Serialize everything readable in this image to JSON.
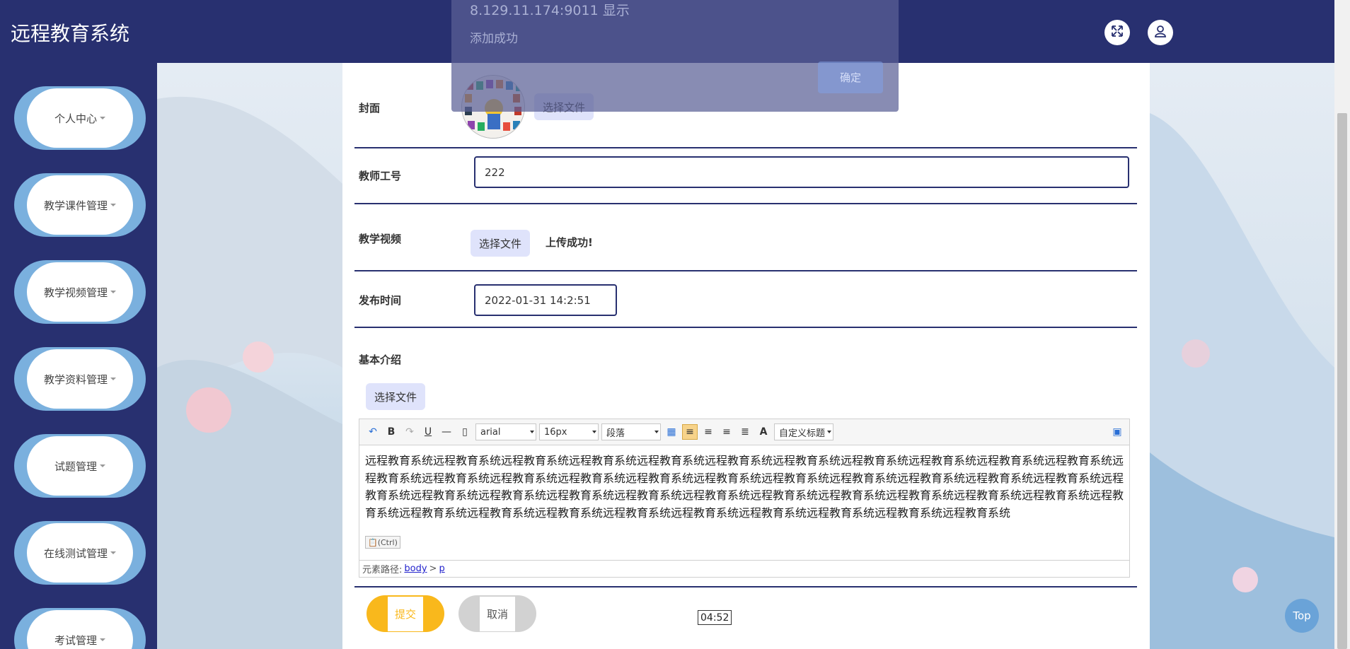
{
  "app": {
    "title": "远程教育系统"
  },
  "header": {
    "fullscreen_icon": "fullscreen-icon",
    "user_icon": "user-icon"
  },
  "sidebar": {
    "items": [
      {
        "label": "个人中心"
      },
      {
        "label": "教学课件管理"
      },
      {
        "label": "教学视频管理"
      },
      {
        "label": "教学资料管理"
      },
      {
        "label": "试题管理"
      },
      {
        "label": "在线测试管理"
      },
      {
        "label": "考试管理"
      }
    ]
  },
  "form": {
    "cover": {
      "label": "封面",
      "choose": "选择文件"
    },
    "teacher_id": {
      "label": "教师工号",
      "value": "222"
    },
    "video": {
      "label": "教学视频",
      "choose": "选择文件",
      "status": "上传成功!"
    },
    "publish_time": {
      "label": "发布时间",
      "value": "2022-01-31 14:2:51"
    },
    "intro": {
      "label": "基本介绍",
      "choose": "选择文件"
    },
    "submit": "提交",
    "cancel": "取消"
  },
  "editor": {
    "font": "arial",
    "size": "16px",
    "paragraph": "段落",
    "custom_title": "自定义标题",
    "content": "远程教育系统远程教育系统远程教育系统远程教育系统远程教育系统远程教育系统远程教育系统远程教育系统远程教育系统远程教育系统远程教育系统远程教育系统远程教育系统远程教育系统远程教育系统远程教育系统远程教育系统远程教育系统远程教育系统远程教育系统远程教育系统远程教育系统远程教育系统远程教育系统远程教育系统远程教育系统远程教育系统远程教育系统远程教育系统远程教育系统远程教育系统远程教育系统远程教育系统远程教育系统远程教育系统远程教育系统远程教育系统远程教育系统远程教育系统远程教育系统远程教育系统远程教育系统远程教育系统",
    "paste_chip": "(Ctrl)",
    "path_label": "元素路径:",
    "path_body": "body",
    "path_sep": ">",
    "path_p": "p"
  },
  "modal": {
    "origin": "8.129.11.174:9011 显示",
    "message": "添加成功",
    "ok": "确定"
  },
  "top_button": "Top",
  "tooltip": "04:52",
  "colors": {
    "navy": "#283070",
    "accent_blue": "#7ab0de",
    "submit_yellow": "#f9b81c",
    "cancel_grey": "#d2d2d2"
  }
}
